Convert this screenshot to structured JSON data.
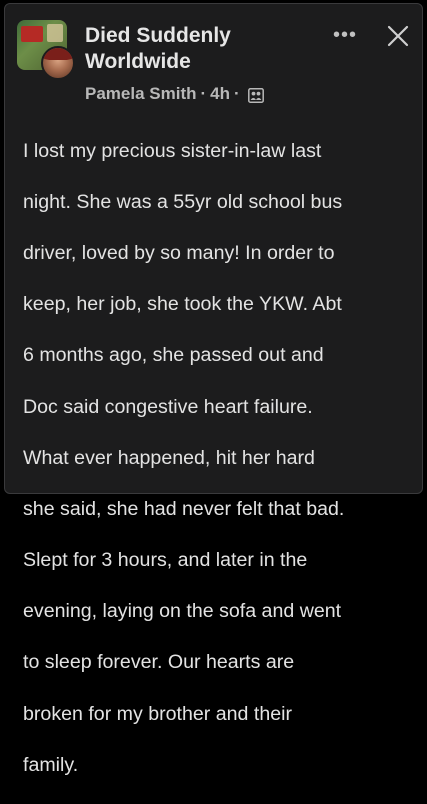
{
  "post": {
    "group_name": "Died Suddenly Worldwide",
    "author": "Pamela Smith",
    "separator": "·",
    "time": "4h",
    "audience_icon": "members-icon",
    "more_label": "•••",
    "body_lines": [
      "I lost my precious sister-in-law last",
      "night. She was a 55yr old school bus",
      "driver, loved by so many! In order to",
      "keep, her job, she took the YKW. Abt",
      "6 months ago, she passed out and",
      "Doc said congestive heart failure.",
      "What ever happened, hit her hard",
      "she said, she had never felt that bad.",
      "Slept for 3 hours, and later in the",
      "evening, laying on the sofa and went",
      "to sleep forever. Our hearts are",
      "broken for my brother and their",
      "family."
    ]
  },
  "colors": {
    "card_background": "#1c1c1d",
    "page_background": "#000000",
    "text_primary": "#e3e3e3",
    "text_secondary": "#b8b8b8"
  }
}
